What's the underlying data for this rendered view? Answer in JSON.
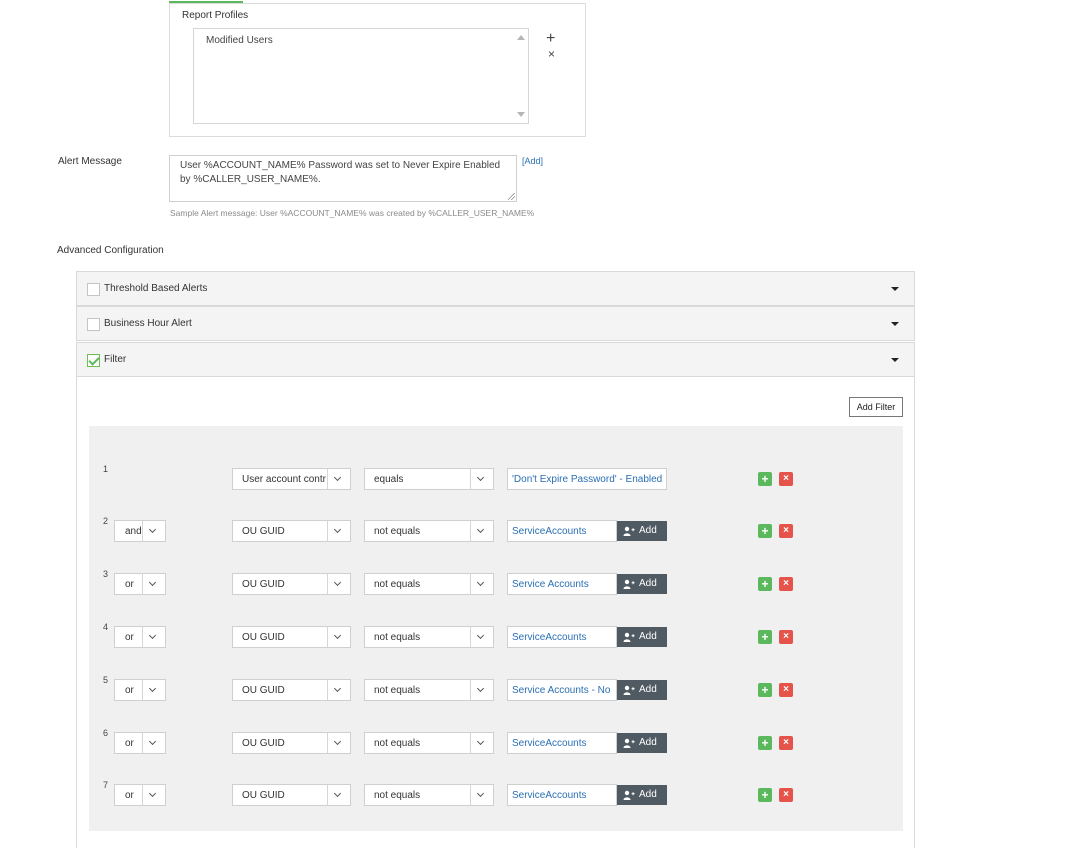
{
  "report_profiles": {
    "title": "Report Profiles",
    "items": [
      "Modified Users"
    ],
    "add_icon": "+",
    "remove_icon": "×"
  },
  "alert_message": {
    "label": "Alert Message",
    "value": "User %ACCOUNT_NAME% Password was set to Never Expire Enabled by %CALLER_USER_NAME%.",
    "add_link": "[Add]",
    "sample": "Sample Alert message: User %ACCOUNT_NAME% was created by %CALLER_USER_NAME%"
  },
  "advanced": {
    "label": "Advanced Configuration",
    "sections": [
      {
        "label": "Threshold Based Alerts",
        "checked": false
      },
      {
        "label": "Business Hour Alert",
        "checked": false
      },
      {
        "label": "Filter",
        "checked": true
      }
    ]
  },
  "filter": {
    "add_filter_label": "Add Filter",
    "add_label": "Add",
    "plus_glyph": "+",
    "delete_glyph": "×",
    "rows": [
      {
        "num": "1",
        "logic": "",
        "field": "User account contr",
        "op": "equals",
        "value": "'Don't Expire Password' - Enabled",
        "has_add": false
      },
      {
        "num": "2",
        "logic": "and",
        "field": "OU GUID",
        "op": "not equals",
        "value": "ServiceAccounts",
        "has_add": true
      },
      {
        "num": "3",
        "logic": "or",
        "field": "OU GUID",
        "op": "not equals",
        "value": "Service Accounts",
        "has_add": true
      },
      {
        "num": "4",
        "logic": "or",
        "field": "OU GUID",
        "op": "not equals",
        "value": "ServiceAccounts",
        "has_add": true
      },
      {
        "num": "5",
        "logic": "or",
        "field": "OU GUID",
        "op": "not equals",
        "value": "Service Accounts - No",
        "has_add": true
      },
      {
        "num": "6",
        "logic": "or",
        "field": "OU GUID",
        "op": "not equals",
        "value": "ServiceAccounts",
        "has_add": true
      },
      {
        "num": "7",
        "logic": "or",
        "field": "OU GUID",
        "op": "not equals",
        "value": "ServiceAccounts",
        "has_add": true
      }
    ]
  },
  "colors": {
    "accent_green": "#5cb85c",
    "delete_red": "#e5534b",
    "link_blue": "#2a6fb3",
    "add_button_bg": "#4f5a63"
  }
}
